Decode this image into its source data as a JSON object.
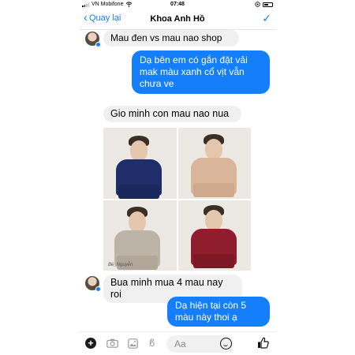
{
  "status_bar": {
    "carrier": "VN Mobifone",
    "wifi_icon": "wifi-icon",
    "time": "07:48",
    "battery_icon": "battery-icon"
  },
  "nav": {
    "back_label": "Quay lại",
    "title": "Khoa Anh Hồ",
    "done_icon": "checkmark-icon"
  },
  "messages": [
    {
      "from": "in",
      "text": "Mau đen vs mau nao shop"
    },
    {
      "from": "out",
      "text": "Dạ bên em có gắn đặt vải mak màu xanh cổ vịt vẫn chưa ve"
    },
    {
      "from": "in",
      "text": "Gio minh con mau nao nua"
    },
    {
      "from": "in",
      "text": "Bua minh mua 4 mau nay roi"
    },
    {
      "from": "out",
      "text": "Dạ hiện tại còn 5 màu này thoi ạ"
    }
  ],
  "photo_grid": {
    "items": [
      {
        "color_name": "navy",
        "color": "#1f2d6b"
      },
      {
        "color_name": "beige",
        "color": "#d9b59a"
      },
      {
        "color_name": "grey",
        "color": "#bdb4a8"
      },
      {
        "color_name": "burgundy",
        "color": "#8f1d2c"
      }
    ],
    "watermark": "Bé_Nguyễn"
  },
  "input_bar": {
    "placeholder": "Aa",
    "icons": [
      "plus-icon",
      "camera-icon",
      "gallery-icon",
      "voice-icon",
      "emoji-icon",
      "like-icon"
    ]
  },
  "colors": {
    "accent": "#147efb",
    "incoming_bubble": "#f0f0f0"
  }
}
